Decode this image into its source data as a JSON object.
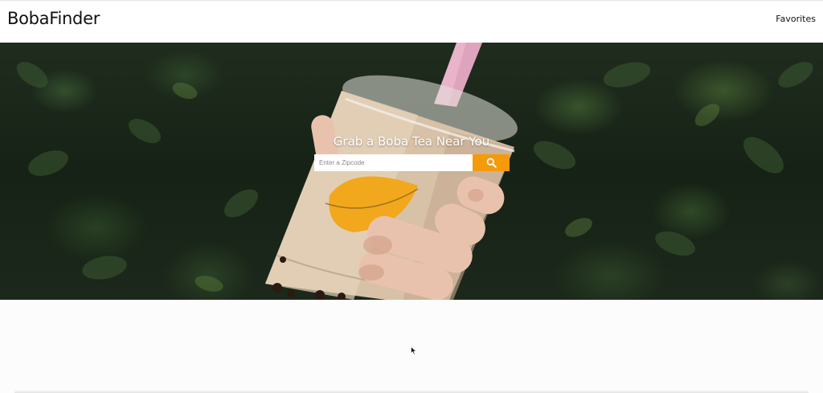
{
  "navbar": {
    "brand": "BobaFinder",
    "links": [
      {
        "label": "Favorites"
      }
    ]
  },
  "hero": {
    "title": "Grab a Boba Tea Near You",
    "search": {
      "placeholder": "Enter a Zipcode",
      "value": "",
      "button_icon": "search-icon"
    }
  },
  "colors": {
    "accent": "#f59a0b",
    "hero_background": "#1c281b",
    "navbar_background": "#ffffff",
    "text": "#111111"
  }
}
